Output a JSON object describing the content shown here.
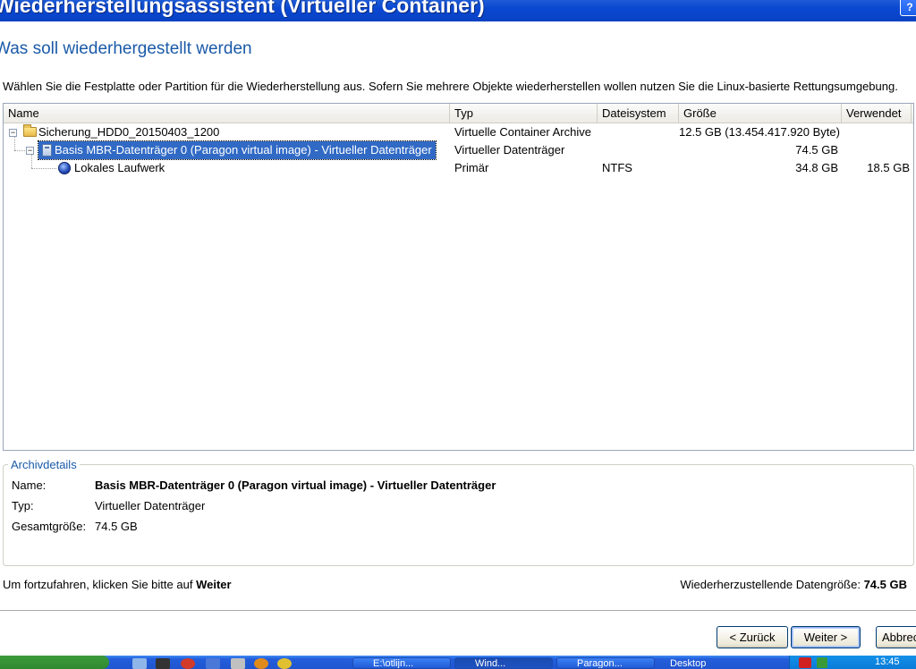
{
  "window": {
    "title": "Wiederherstellungsassistent (Virtueller Container)",
    "help_label": "?"
  },
  "heading": "Was soll wiederhergestellt werden",
  "instruction": "Wählen Sie die Festplatte oder Partition für die Wiederherstellung aus. Sofern Sie mehrere Objekte wiederherstellen wollen nutzen Sie die Linux-basierte Rettungsumgebung.",
  "tree": {
    "columns": [
      "Name",
      "Typ",
      "Dateisystem",
      "Größe",
      "Verwendet"
    ],
    "rows": [
      {
        "expander": "−",
        "icon": "folder-icon",
        "name": "Sicherung_HDD0_20150403_1200",
        "type": "Virtuelle Container Archive",
        "filesystem": "",
        "size": "12.5 GB (13.454.417.920 Byte)",
        "used": ""
      },
      {
        "expander": "−",
        "icon": "disk-icon",
        "name": "Basis MBR-Datenträger 0 (Paragon virtual image) - Virtueller Datenträger",
        "type": "Virtueller Datenträger",
        "filesystem": "",
        "size": "74.5 GB",
        "used": "",
        "selected": true
      },
      {
        "expander": "",
        "icon": "volume-icon",
        "name": "Lokales Laufwerk",
        "type": "Primär",
        "filesystem": "NTFS",
        "size": "34.8 GB",
        "used": "18.5 GB"
      }
    ]
  },
  "details": {
    "legend": "Archivdetails",
    "name_label": "Name:",
    "name_value": "Basis MBR-Datenträger 0 (Paragon virtual image) - Virtueller Datenträger",
    "type_label": "Typ:",
    "type_value": "Virtueller Datenträger",
    "total_label": "Gesamtgröße:",
    "total_value": "74.5 GB"
  },
  "footer": {
    "continue_prefix": "Um fortzufahren, klicken Sie bitte auf",
    "continue_bold": "Weiter",
    "restore_size_label": "Wiederherzustellende Datengröße:",
    "restore_size_value": "74.5 GB"
  },
  "buttons": {
    "back": "< Zurück",
    "next": "Weiter >",
    "cancel": "Abbrechen"
  },
  "taskbar": {
    "tasks": [
      "E:\\otlijn...",
      "Wind...",
      "Paragon...",
      "Desktop"
    ],
    "clock": "13:45"
  }
}
